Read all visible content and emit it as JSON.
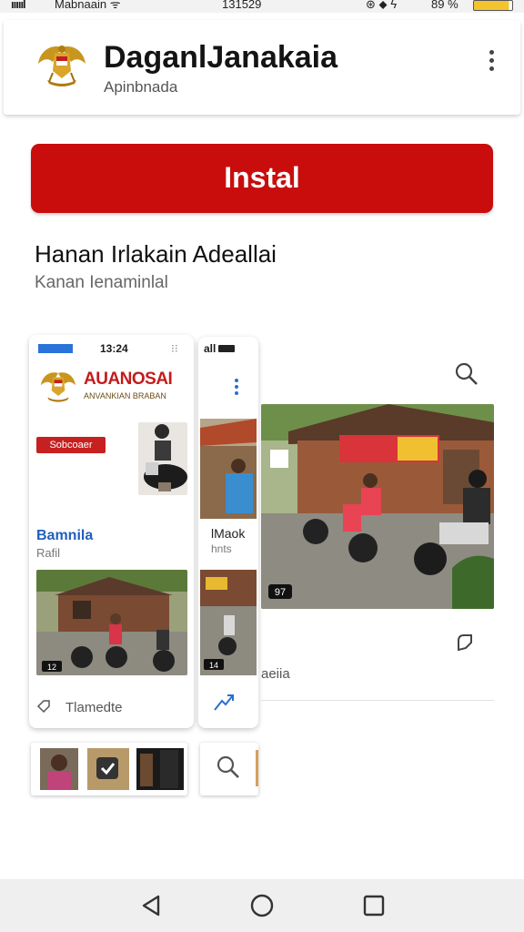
{
  "status_bar": {
    "signal": "ıııııl",
    "carrier": "Mabnaain ᯤ",
    "time": "131529",
    "icons": "⊛ ⬥ ϟ",
    "battery": "89 %"
  },
  "header": {
    "title": "DaganlJanakaia",
    "subtitle": "Apinbnada",
    "logo_icon": "garuda-emblem-icon",
    "menu_icon": "more-vertical-icon"
  },
  "install_label": "Instal",
  "section": {
    "title": "Hanan Irlakain Adeallai",
    "subtitle": "Kanan Ienaminlal"
  },
  "screenshots": [
    {
      "badge": "",
      "time": "13:24",
      "dots": "⁝⁝",
      "title": "AUANOSAI",
      "subtitle": "ANVANKIAN BRABAN",
      "tag": "Sobcoaer",
      "label_1": "Bamnila",
      "label_2": "Rafil",
      "scene_badge": "12",
      "footer": "Tlamedte"
    },
    {
      "status": "all",
      "label_1": "lMaok",
      "label_2": "hnts",
      "scene_badge": "14"
    }
  ],
  "main_screenshot": {
    "scene_badge": "97",
    "label": "aeiia"
  },
  "colors": {
    "primary_red": "#c90d0d",
    "accent_blue": "#2a6ed0",
    "nav_bg": "#efefef"
  },
  "nav": {
    "back_icon": "triangle-back-icon",
    "home_icon": "circle-home-icon",
    "recent_icon": "square-recents-icon"
  }
}
